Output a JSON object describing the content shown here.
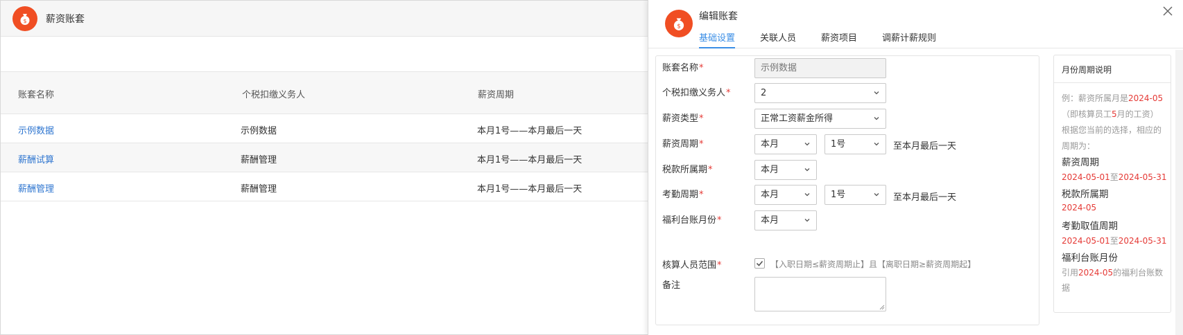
{
  "app": {
    "title": "薪资账套",
    "icon": "money-bag-icon"
  },
  "table": {
    "headers": [
      "账套名称",
      "个税扣缴义务人",
      "薪资周期"
    ],
    "rows": [
      {
        "name": "示例数据",
        "tax_agent": "示例数据",
        "cycle": "本月1号——本月最后一天"
      },
      {
        "name": "薪酬试算",
        "tax_agent": "薪酬管理",
        "cycle": "本月1号——本月最后一天"
      },
      {
        "name": "薪酬管理",
        "tax_agent": "薪酬管理",
        "cycle": "本月1号——本月最后一天"
      }
    ]
  },
  "drawer": {
    "title": "编辑账套",
    "close_icon": "close-icon",
    "tabs": [
      "基础设置",
      "关联人员",
      "薪资项目",
      "调薪计薪规则"
    ],
    "active_tab": 0,
    "form": {
      "name_label": "账套名称",
      "name_value": "示例数据",
      "tax_agent_label": "个税扣缴义务人",
      "tax_agent_value": "2",
      "salary_type_label": "薪资类型",
      "salary_type_value": "正常工资薪金所得",
      "salary_cycle_label": "薪资周期",
      "salary_cycle_month": "本月",
      "salary_cycle_day": "1号",
      "salary_cycle_suffix": "至本月最后一天",
      "tax_period_label": "税款所属期",
      "tax_period_value": "本月",
      "attendance_label": "考勤周期",
      "attendance_month": "本月",
      "attendance_day": "1号",
      "attendance_suffix": "至本月最后一天",
      "welfare_label": "福利台账月份",
      "welfare_value": "本月",
      "scope_label": "核算人员范围",
      "scope_checked": true,
      "scope_text": "【入职日期≤薪资周期止】且【离职日期≥薪资周期起】",
      "remark_label": "备注",
      "remark_value": "",
      "required_mark": "*"
    },
    "help": {
      "title": "月份周期说明",
      "ex_line1_a": "例：薪资所属月是",
      "ex_line1_b": "2024-05",
      "ex_line2_a": "（即核算员工",
      "ex_line2_b": "5",
      "ex_line2_c": "月的工资）",
      "ex_line3": "根据您当前的选择，相应的",
      "ex_line4": "周期为：",
      "salary_cycle_head": "薪资周期",
      "salary_cycle_start": "2024-05-01",
      "to": "至",
      "salary_cycle_end": "2024-05-31",
      "tax_period_head": "税款所属期",
      "tax_period_value": "2024-05",
      "attendance_head": "考勤取值周期",
      "attendance_start": "2024-05-01",
      "attendance_end": "2024-05-31",
      "welfare_head": "福利台账月份",
      "welfare_a": "引用",
      "welfare_b": "2024-05",
      "welfare_c": "的福利台账数",
      "welfare_d": "据"
    }
  },
  "colors": {
    "brand": "#f04e23",
    "link": "#2f76d0",
    "tab_active": "#3a8ee6",
    "required": "#e53935"
  }
}
